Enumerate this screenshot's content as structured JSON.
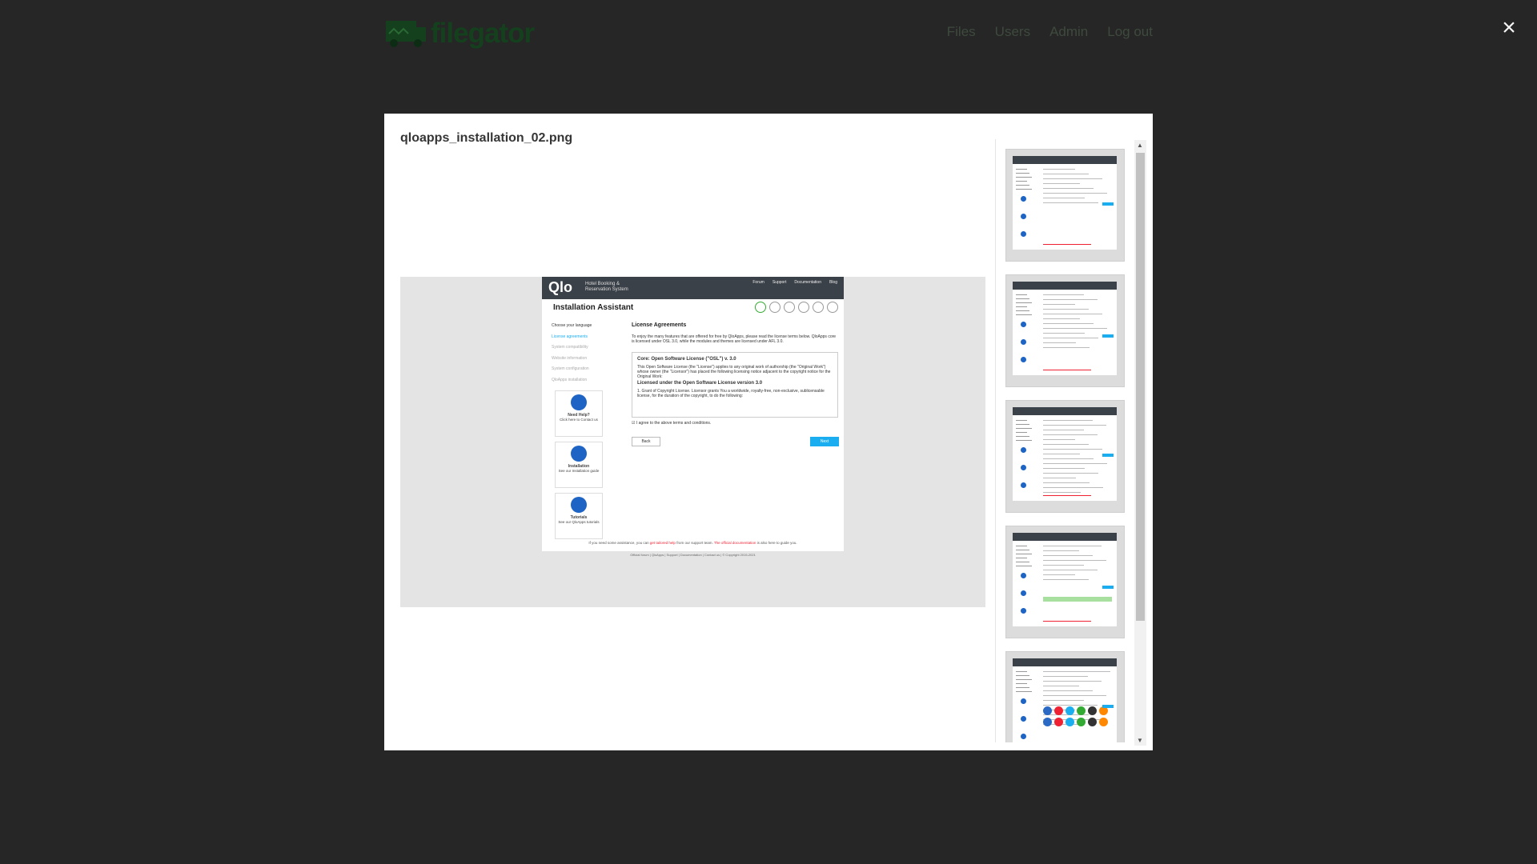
{
  "app": {
    "logo_text": "filegator",
    "nav": [
      "Files",
      "Users",
      "Admin",
      "Log out"
    ]
  },
  "close_glyph": "×",
  "modal": {
    "title": "qloapps_installation_02.png",
    "thumbnail_count": 5
  },
  "preview": {
    "brand": "Qlo",
    "tagline": "Hotel Booking & Reservation System",
    "nav": [
      "Forum",
      "Support",
      "Documentation",
      "Blog"
    ],
    "title": "Installation Assistant",
    "steps": [
      "Choose your language",
      "License agreements",
      "System compatibility",
      "Website information",
      "System configuration",
      "QloApps installation"
    ],
    "cards": [
      {
        "title": "Need Help?",
        "text": "Click here to Contact us"
      },
      {
        "title": "Installation",
        "text": "See our Installation guide"
      },
      {
        "title": "Tutorials",
        "text": "See our QloApps tutorials"
      }
    ],
    "heading": "License Agreements",
    "intro": "To enjoy the many features that are offered for free by QloApps, please read the license terms below. QloApps core is licensed under OSL 3.0, while the modules and themes are licensed under AFL 3.0.",
    "license_title": "Core: Open Software License (\"OSL\") v. 3.0",
    "license_text": "This Open Software License (the \"License\") applies to any original work of authorship (the \"Original Work\") whose owner (the \"Licensor\") has placed the following licensing notice adjacent to the copyright notice for the Original Work:",
    "license_sub": "Licensed under the Open Software License version 3.0",
    "license_grant": "1. Grant of Copyright License. Licensor grants You a worldwide, royalty-free, non-exclusive, sublicensable license, for the duration of the copyright, to do the following:",
    "agree": "I agree to the above terms and conditions.",
    "back": "Back",
    "next": "Next",
    "footer_help_a": "If you need some assistance, you can",
    "footer_help_link": "get tailored help",
    "footer_help_b": "from our support team.",
    "footer_doc_link": "The official documentation",
    "footer_help_c": "is also here to guide you.",
    "footer_links": "Official forum | QloApps | Support | Documentation | Contact us | © Copyright 2015-2021"
  },
  "colors": {
    "accent": "#1aaef0",
    "brand_dark": "#3b4148",
    "backdrop": "#262626"
  }
}
